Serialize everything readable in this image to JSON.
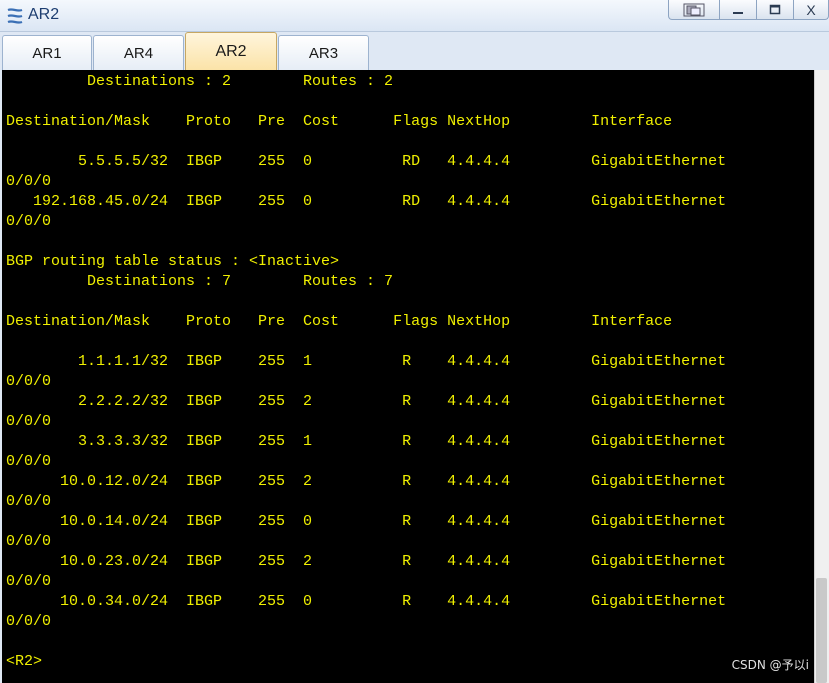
{
  "window": {
    "title": "AR2",
    "app_icon": "router-app-icon",
    "buttons": [
      {
        "name": "restore-windows-button",
        "glyph": "◫"
      },
      {
        "name": "minimize-button",
        "glyph": "—"
      },
      {
        "name": "maximize-button",
        "glyph": "▭"
      },
      {
        "name": "close-button",
        "glyph": "X"
      }
    ]
  },
  "tabs": [
    {
      "label": "AR1",
      "active": false
    },
    {
      "label": "AR4",
      "active": false
    },
    {
      "label": "AR2",
      "active": true
    },
    {
      "label": "AR3",
      "active": false
    }
  ],
  "terminal": {
    "text_color": "#f0f000",
    "background": "#000000",
    "lines": [
      "         Destinations : 2        Routes : 2",
      "",
      "Destination/Mask    Proto   Pre  Cost      Flags NextHop         Interface",
      "",
      "        5.5.5.5/32  IBGP    255  0          RD   4.4.4.4         GigabitEthernet",
      "0/0/0",
      "   192.168.45.0/24  IBGP    255  0          RD   4.4.4.4         GigabitEthernet",
      "0/0/0",
      "",
      "BGP routing table status : <Inactive>",
      "         Destinations : 7        Routes : 7",
      "",
      "Destination/Mask    Proto   Pre  Cost      Flags NextHop         Interface",
      "",
      "        1.1.1.1/32  IBGP    255  1          R    4.4.4.4         GigabitEthernet",
      "0/0/0",
      "        2.2.2.2/32  IBGP    255  2          R    4.4.4.4         GigabitEthernet",
      "0/0/0",
      "        3.3.3.3/32  IBGP    255  1          R    4.4.4.4         GigabitEthernet",
      "0/0/0",
      "      10.0.12.0/24  IBGP    255  2          R    4.4.4.4         GigabitEthernet",
      "0/0/0",
      "      10.0.14.0/24  IBGP    255  0          R    4.4.4.4         GigabitEthernet",
      "0/0/0",
      "      10.0.23.0/24  IBGP    255  2          R    4.4.4.4         GigabitEthernet",
      "0/0/0",
      "      10.0.34.0/24  IBGP    255  0          R    4.4.4.4         GigabitEthernet",
      "0/0/0",
      "",
      "<R2>"
    ]
  },
  "watermark": "CSDN @予以i"
}
